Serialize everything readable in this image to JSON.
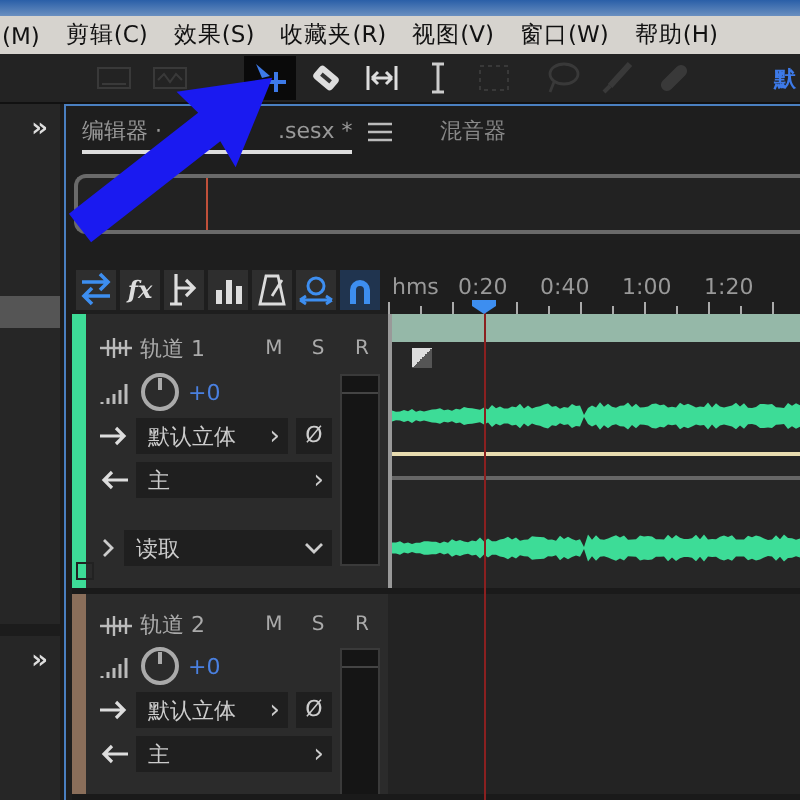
{
  "menu_bar": {
    "items": [
      "(M)",
      "剪辑(C)",
      "效果(S)",
      "收藏夹(R)",
      "视图(V)",
      "窗口(W)",
      "帮助(H)"
    ]
  },
  "toolbar": {
    "tools": [
      {
        "kind": "spectral",
        "selected": false,
        "disabled": true
      },
      {
        "kind": "pitch",
        "selected": false,
        "disabled": true
      },
      {
        "kind": "move",
        "selected": true,
        "disabled": false
      },
      {
        "kind": "razor",
        "selected": false,
        "disabled": false
      },
      {
        "kind": "slip",
        "selected": false,
        "disabled": false
      },
      {
        "kind": "ibeam",
        "selected": false,
        "disabled": false
      },
      {
        "kind": "marquee",
        "selected": false,
        "disabled": true
      },
      {
        "kind": "lasso",
        "selected": false,
        "disabled": true
      },
      {
        "kind": "brush",
        "selected": false,
        "disabled": true
      },
      {
        "kind": "heal",
        "selected": false,
        "disabled": true
      }
    ],
    "workspace": "默"
  },
  "left_panels": [
    {
      "expand": "»"
    },
    {
      "expand": "»"
    }
  ],
  "editor": {
    "tabs": [
      {
        "label_start": "编辑器 ·",
        "label_end": ".sesx *",
        "selected": true,
        "menu": true
      },
      {
        "label_start": "混音器",
        "selected": false,
        "menu": false
      }
    ],
    "track_tools": [
      {
        "kind": "swap",
        "selected": true
      },
      {
        "kind": "fx",
        "label": "fx",
        "selected": false
      },
      {
        "kind": "send",
        "selected": false
      },
      {
        "kind": "eq",
        "selected": false
      },
      {
        "kind": "metronome",
        "selected": false
      },
      {
        "kind": "stretch",
        "selected": true
      },
      {
        "kind": "snap",
        "selected": true
      }
    ],
    "ruler": {
      "unit": "hms",
      "ticks": [
        "0:20",
        "0:40",
        "1:00",
        "1:20"
      ]
    },
    "tracks": [
      {
        "name": "轨道 1",
        "color": "#3ddc97",
        "mute": "M",
        "solo": "S",
        "record": "R",
        "volume": "+0",
        "output": "默认立体",
        "output_arrow": "›",
        "phase": "Ø",
        "input": "主",
        "input_arrow": "›",
        "automation": "读取",
        "has_clip": true
      },
      {
        "name": "轨道 2",
        "color": "#8a6e5a",
        "mute": "M",
        "solo": "S",
        "record": "R",
        "volume": "+0",
        "output": "默认立体",
        "output_arrow": "›",
        "phase": "Ø",
        "input": "主",
        "input_arrow": "›",
        "has_clip": false
      }
    ]
  }
}
